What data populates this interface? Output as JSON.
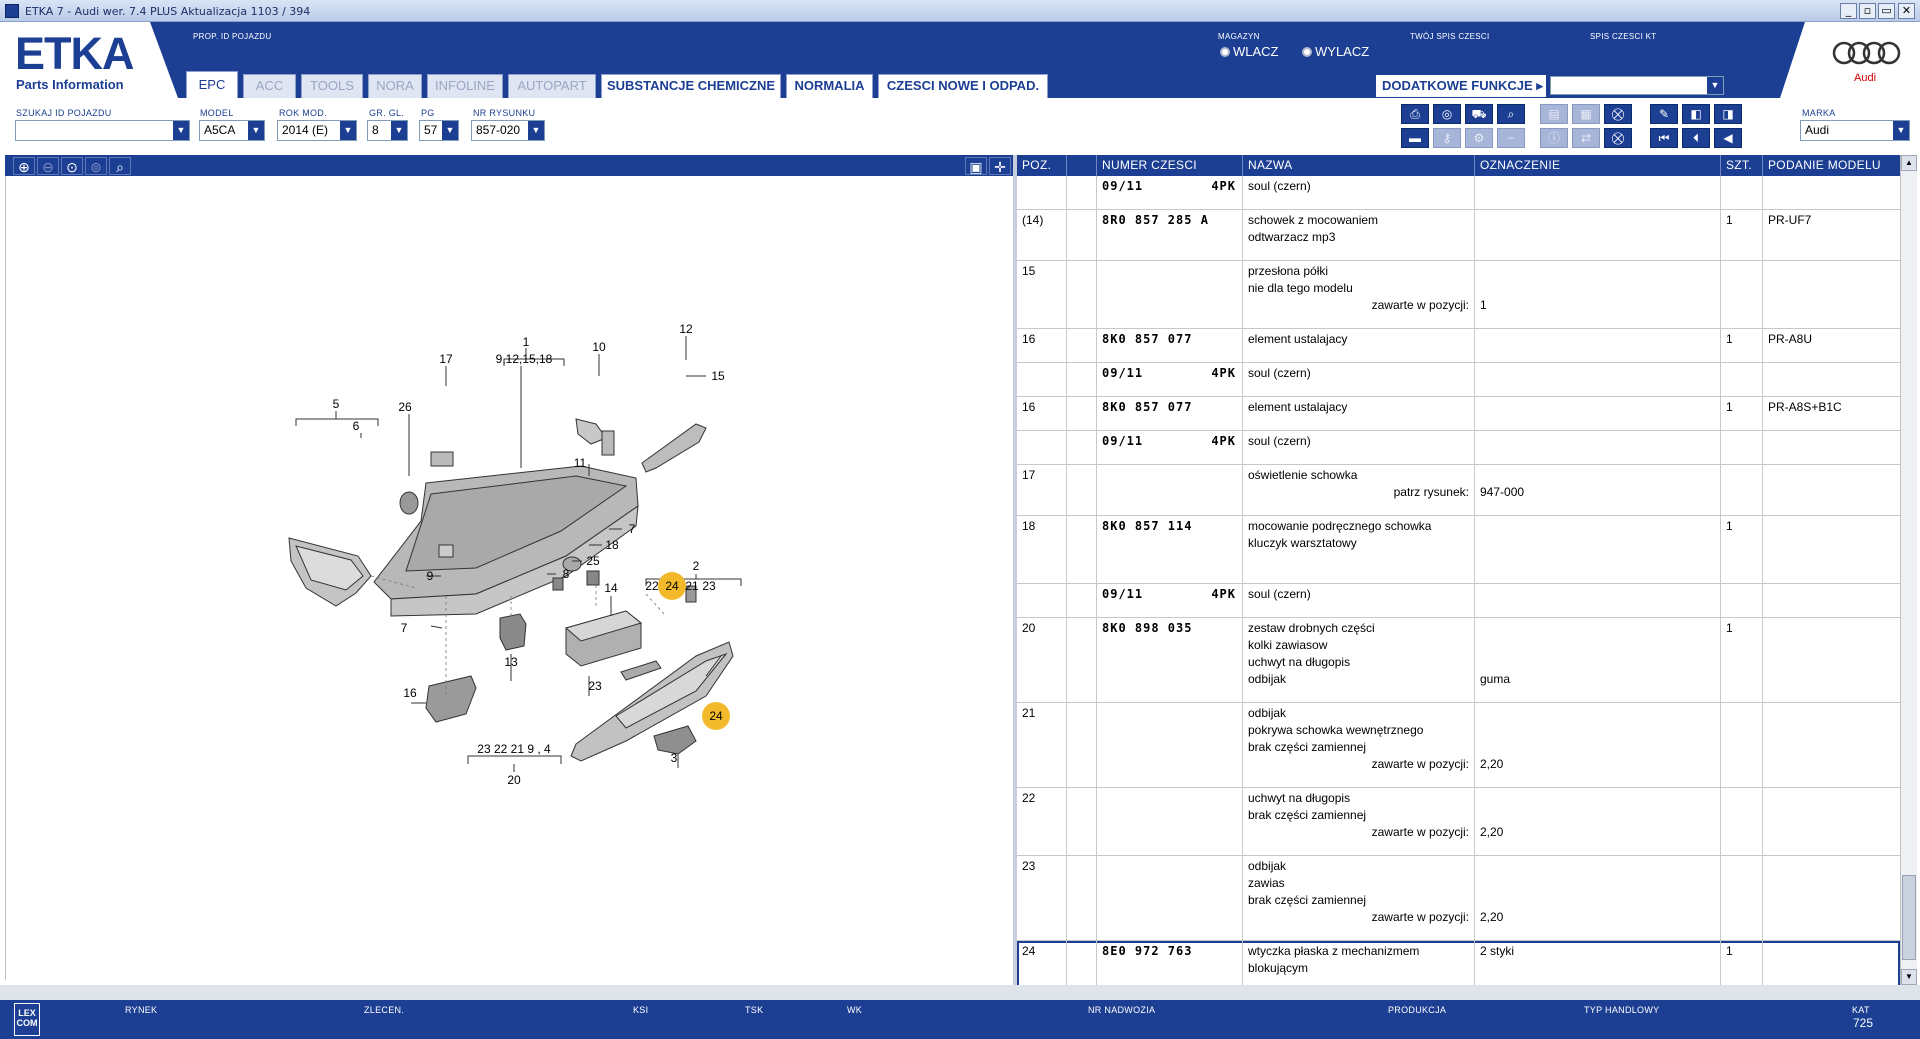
{
  "window": {
    "title": "ETKA 7 - Audi wer. 7.4 PLUS Aktualizacja 1103 / 394"
  },
  "brand": {
    "etka": "ETKA",
    "sub": "Parts Information",
    "audi": "Audi",
    "accent": "#1c3f94"
  },
  "header": {
    "prop_id_label": "PROP. ID POJAZDU",
    "magazyn_label": "MAGAZYN",
    "wlacz": "WLACZ",
    "wylacz": "WYLACZ",
    "twoj_spis": "TWÓJ SPIS CZESCI",
    "spis_kt": "SPIS CZESCI KT",
    "dodatkowe": "DODATKOWE FUNKCJE"
  },
  "tabs": [
    "EPC",
    "ACC",
    "TOOLS",
    "NORA",
    "INFOLINE",
    "AUTOPART",
    "SUBSTANCJE CHEMICZNE",
    "NORMALIA",
    "CZESCI NOWE I ODPAD."
  ],
  "filters": {
    "szukaj_label": "SZUKAJ ID POJAZDU",
    "szukaj_value": "",
    "model_label": "MODEL",
    "model_value": "A5CA",
    "rok_label": "ROK MOD.",
    "rok_value": "2014 (E)",
    "gr_label": "GR. GL.",
    "gr_value": "8",
    "pg_label": "PG",
    "pg_value": "57",
    "nr_label": "NR RYSUNKU",
    "nr_value": "857-020",
    "marka_label": "MARKA",
    "marka_value": "Audi"
  },
  "grid_headers": [
    "POZ.",
    "",
    "NUMER CZESCI",
    "NAZWA",
    "OZNACZENIE",
    "SZT.",
    "PODANIE MODELU"
  ],
  "rows": [
    {
      "poz": "",
      "nr": "09/11",
      "pk": "4PK",
      "name": [
        "soul (czern)"
      ],
      "ozn": "",
      "szt": "",
      "model": ""
    },
    {
      "poz": "(14)",
      "nr": "8R0 857 285 A",
      "pk": "",
      "name": [
        "schowek z mocowaniem",
        "odtwarzacz mp3"
      ],
      "ozn": "",
      "szt": "1",
      "model": "PR-UF7"
    },
    {
      "poz": "15",
      "nr": "",
      "pk": "",
      "name": [
        "przesłona półki",
        "nie dla tego modelu"
      ],
      "sub": "zawarte w pozycji:",
      "ozn_sub": "1",
      "ozn": "",
      "szt": "",
      "model": ""
    },
    {
      "poz": "16",
      "nr": "8K0 857 077",
      "pk": "",
      "name": [
        "element ustalajacy"
      ],
      "ozn": "",
      "szt": "1",
      "model": "PR-A8U"
    },
    {
      "poz": "",
      "nr": "09/11",
      "pk": "4PK",
      "name": [
        "soul (czern)"
      ],
      "ozn": "",
      "szt": "",
      "model": ""
    },
    {
      "poz": "16",
      "nr": "8K0 857 077",
      "pk": "",
      "name": [
        "element ustalajacy"
      ],
      "ozn": "",
      "szt": "1",
      "model": "PR-A8S+B1C"
    },
    {
      "poz": "",
      "nr": "09/11",
      "pk": "4PK",
      "name": [
        "soul (czern)"
      ],
      "ozn": "",
      "szt": "",
      "model": ""
    },
    {
      "poz": "17",
      "nr": "",
      "pk": "",
      "name": [
        "oświetlenie schowka"
      ],
      "sub": "patrz rysunek:",
      "ozn_sub": "947-000",
      "ozn": "",
      "szt": "",
      "model": ""
    },
    {
      "poz": "18",
      "nr": "8K0 857 114",
      "pk": "",
      "name": [
        "mocowanie podręcznego schowka",
        "kluczyk warsztatowy"
      ],
      "ozn": "",
      "szt": "1",
      "model": ""
    },
    {
      "poz": "",
      "nr": "09/11",
      "pk": "4PK",
      "name": [
        "soul (czern)"
      ],
      "ozn": "",
      "szt": "",
      "model": ""
    },
    {
      "poz": "20",
      "nr": "8K0 898 035",
      "pk": "",
      "name": [
        "zestaw drobnych części",
        "kolki zawiasow",
        "uchwyt na długopis",
        "odbijak"
      ],
      "ozn": "guma",
      "szt": "1",
      "model": ""
    },
    {
      "poz": "21",
      "nr": "",
      "pk": "",
      "name": [
        "odbijak",
        "pokrywa schowka wewnętrznego",
        "brak części zamiennej"
      ],
      "sub": "zawarte w pozycji:",
      "ozn_sub": "2,20",
      "ozn": "",
      "szt": "",
      "model": ""
    },
    {
      "poz": "22",
      "nr": "",
      "pk": "",
      "name": [
        "uchwyt na długopis",
        "brak części zamiennej"
      ],
      "sub": "zawarte w pozycji:",
      "ozn_sub": "2,20",
      "ozn": "",
      "szt": "",
      "model": ""
    },
    {
      "poz": "23",
      "nr": "",
      "pk": "",
      "name": [
        "odbijak",
        "zawias",
        "brak części zamiennej"
      ],
      "sub": "zawarte w pozycji:",
      "ozn_sub": "2,20",
      "ozn": "",
      "szt": "",
      "model": ""
    },
    {
      "poz": "24",
      "nr": "8E0 972 763",
      "pk": "",
      "name": [
        "wtyczka płaska z mechanizmem",
        "blokującym"
      ],
      "ozn": "2 styki",
      "szt": "1",
      "model": ""
    }
  ],
  "diagram_labels": [
    "1",
    "9,12,15,18",
    "10",
    "12",
    "15",
    "17",
    "26",
    "5",
    "6",
    "11",
    "7",
    "18",
    "25",
    "9",
    "8",
    "2",
    "22",
    "24",
    "21",
    "23",
    "14",
    "13",
    "7",
    "16",
    "23",
    "24",
    "3",
    "23  22  21  9 ,  4",
    "20"
  ],
  "status": {
    "rynek": "RYNEK",
    "zlecen": "ZLECEN.",
    "ksi": "KSI",
    "tsk": "TSK",
    "wk": "WK",
    "nr_nadwozia": "NR NADWOZIA",
    "produkcja": "PRODUKCJA",
    "typ": "TYP HANDLOWY",
    "kat": "KAT",
    "kat_value": "725",
    "lex": "LEX COM"
  }
}
